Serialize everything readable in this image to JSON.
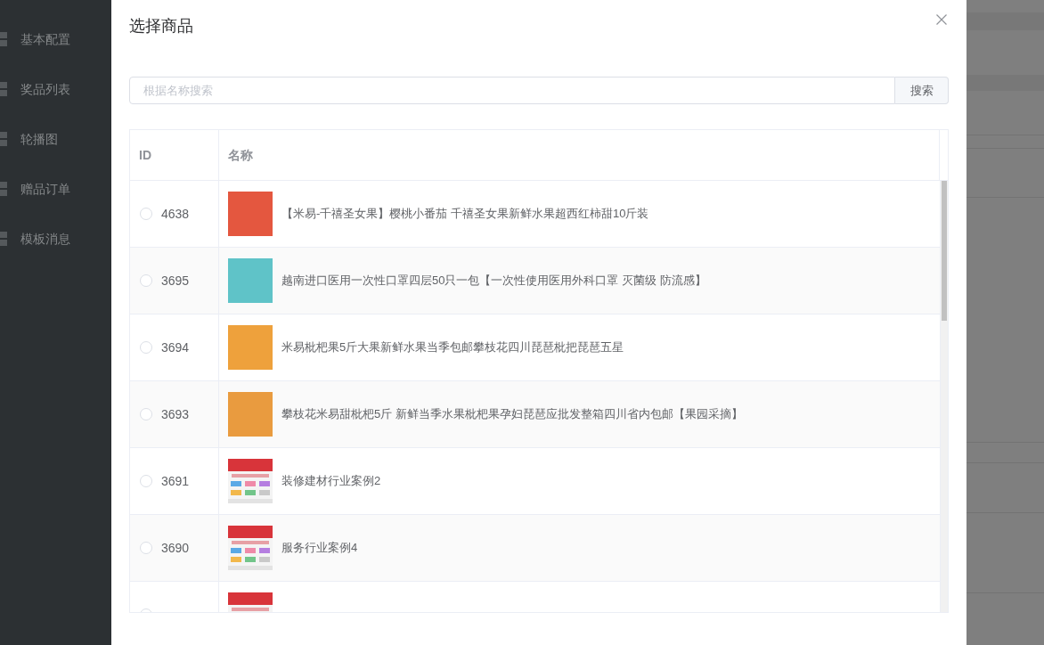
{
  "sidebar": {
    "items": [
      {
        "label": "基本配置"
      },
      {
        "label": "奖品列表"
      },
      {
        "label": "轮播图"
      },
      {
        "label": "赠品订单"
      },
      {
        "label": "模板消息"
      }
    ]
  },
  "dialog": {
    "title": "选择商品",
    "search": {
      "placeholder": "根据名称搜索",
      "button": "搜索"
    },
    "table": {
      "columns": [
        {
          "label": "ID"
        },
        {
          "label": "名称"
        }
      ],
      "rows": [
        {
          "id": "4638",
          "name": "【米易-千禧圣女果】樱桃小番茄 千禧圣女果新鲜水果超西红柿甜10斤装",
          "selected": false,
          "kind": "photo"
        },
        {
          "id": "3695",
          "name": "越南进口医用一次性口罩四层50只一包【一次性使用医用外科口罩 灭菌级 防流感】",
          "selected": false,
          "kind": "photo"
        },
        {
          "id": "3694",
          "name": "米易枇杷果5斤大果新鲜水果当季包邮攀枝花四川琵琶枇把琵琶五星",
          "selected": false,
          "kind": "photo"
        },
        {
          "id": "3693",
          "name": "攀枝花米易甜枇杷5斤 新鲜当季水果枇杷果孕妇琵琶应批发整箱四川省内包邮【果园采摘】",
          "selected": false,
          "kind": "photo"
        },
        {
          "id": "3691",
          "name": "装修建材行业案例2",
          "selected": false,
          "kind": "webpage"
        },
        {
          "id": "3690",
          "name": "服务行业案例4",
          "selected": false,
          "kind": "webpage"
        },
        {
          "selected": false,
          "kind": "webpage"
        }
      ]
    }
  }
}
